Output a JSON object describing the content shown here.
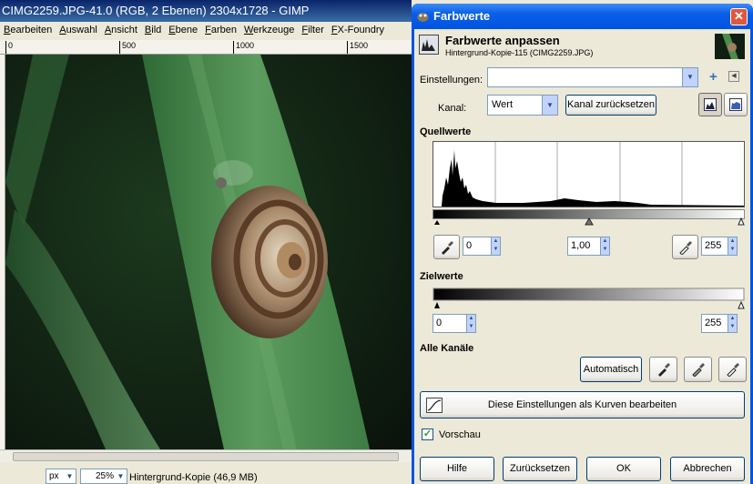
{
  "gimp_window": {
    "title": "CIMG2259.JPG-41.0 (RGB, 2 Ebenen) 2304x1728 - GIMP",
    "menu": [
      "Bearbeiten",
      "Auswahl",
      "Ansicht",
      "Bild",
      "Ebene",
      "Farben",
      "Werkzeuge",
      "Filter",
      "FX-Foundry"
    ],
    "ruler_labels": [
      "0",
      "500",
      "1000",
      "1500"
    ],
    "status": {
      "unit": "px",
      "zoom": "25%",
      "layer_info": "Hintergrund-Kopie (46,9 MB)"
    }
  },
  "dialog": {
    "title": "Farbwerte",
    "header_title": "Farbwerte anpassen",
    "header_subtitle": "Hintergrund-Kopie-115 (CIMG2259.JPG)",
    "einstellungen_label": "Einstellungen:",
    "einstellungen_value": "",
    "kanal_label": "Kanal:",
    "kanal_value": "Wert",
    "kanal_reset_button": "Kanal zurücksetzen",
    "quellwerte_heading": "Quellwerte",
    "input_low": "0",
    "input_gamma": "1,00",
    "input_high": "255",
    "zielwerte_heading": "Zielwerte",
    "output_low": "0",
    "output_high": "255",
    "alle_kanaele_heading": "Alle Kanäle",
    "auto_button": "Automatisch",
    "curves_button": "Diese Einstellungen als Kurven bearbeiten",
    "preview_label": "Vorschau",
    "preview_checked": true,
    "buttons": {
      "help": "Hilfe",
      "reset": "Zurücksetzen",
      "ok": "OK",
      "cancel": "Abbrechen"
    },
    "icons": [
      "plus-icon",
      "menu-arrow-icon",
      "linear-histogram-icon",
      "log-histogram-icon",
      "picker-black-icon",
      "picker-gray-icon",
      "picker-white-icon",
      "curves-icon",
      "checkmark-icon",
      "close-icon"
    ]
  }
}
